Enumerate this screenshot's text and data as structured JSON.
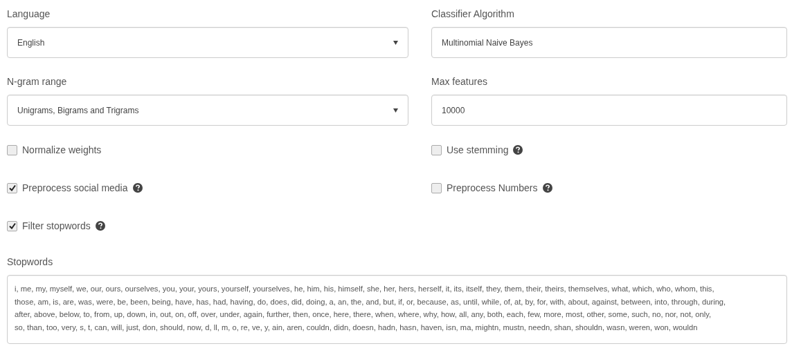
{
  "fields": [
    {
      "label": "Language",
      "kind": "select",
      "value": "English"
    },
    {
      "label": "Classifier Algorithm",
      "kind": "select_cut",
      "value": "Multinomial Naive Bayes"
    },
    {
      "label": "N-gram range",
      "kind": "select",
      "value": "Unigrams, Bigrams and Trigrams"
    },
    {
      "label": "Max features",
      "kind": "input",
      "value": "10000"
    }
  ],
  "options": [
    {
      "label": "Normalize weights",
      "checked": false,
      "help": false
    },
    {
      "label": "Use stemming",
      "checked": false,
      "help": true
    },
    {
      "label": "Preprocess social media",
      "checked": true,
      "help": true
    },
    {
      "label": "Preprocess Numbers",
      "checked": false,
      "help": true
    },
    {
      "label": "Filter stopwords",
      "checked": true,
      "help": true
    }
  ],
  "stopwords": {
    "label": "Stopwords",
    "lines": [
      "i, me, my, myself, we, our, ours, ourselves, you, your, yours, yourself, yourselves, he, him, his, himself, she, her, hers, herself, it, its, itself, they, them, their, theirs, themselves, what, which, who, whom, this,",
      "those, am, is, are, was, were, be, been, being, have, has, had, having, do, does, did, doing, a, an, the, and, but, if, or, because, as, until, while, of, at, by, for, with, about, against, between, into, through, during,",
      "after, above, below, to, from, up, down, in, out, on, off, over, under, again, further, then, once, here, there, when, where, why, how, all, any, both, each, few, more, most, other, some, such, no, nor, not, only,",
      "so, than, too, very, s, t, can, will, just, don, should, now, d, ll, m, o, re, ve, y, ain, aren, couldn, didn, doesn, hadn, hasn, haven, isn, ma, mightn, mustn, needn, shan, shouldn, wasn, weren, won, wouldn"
    ]
  }
}
